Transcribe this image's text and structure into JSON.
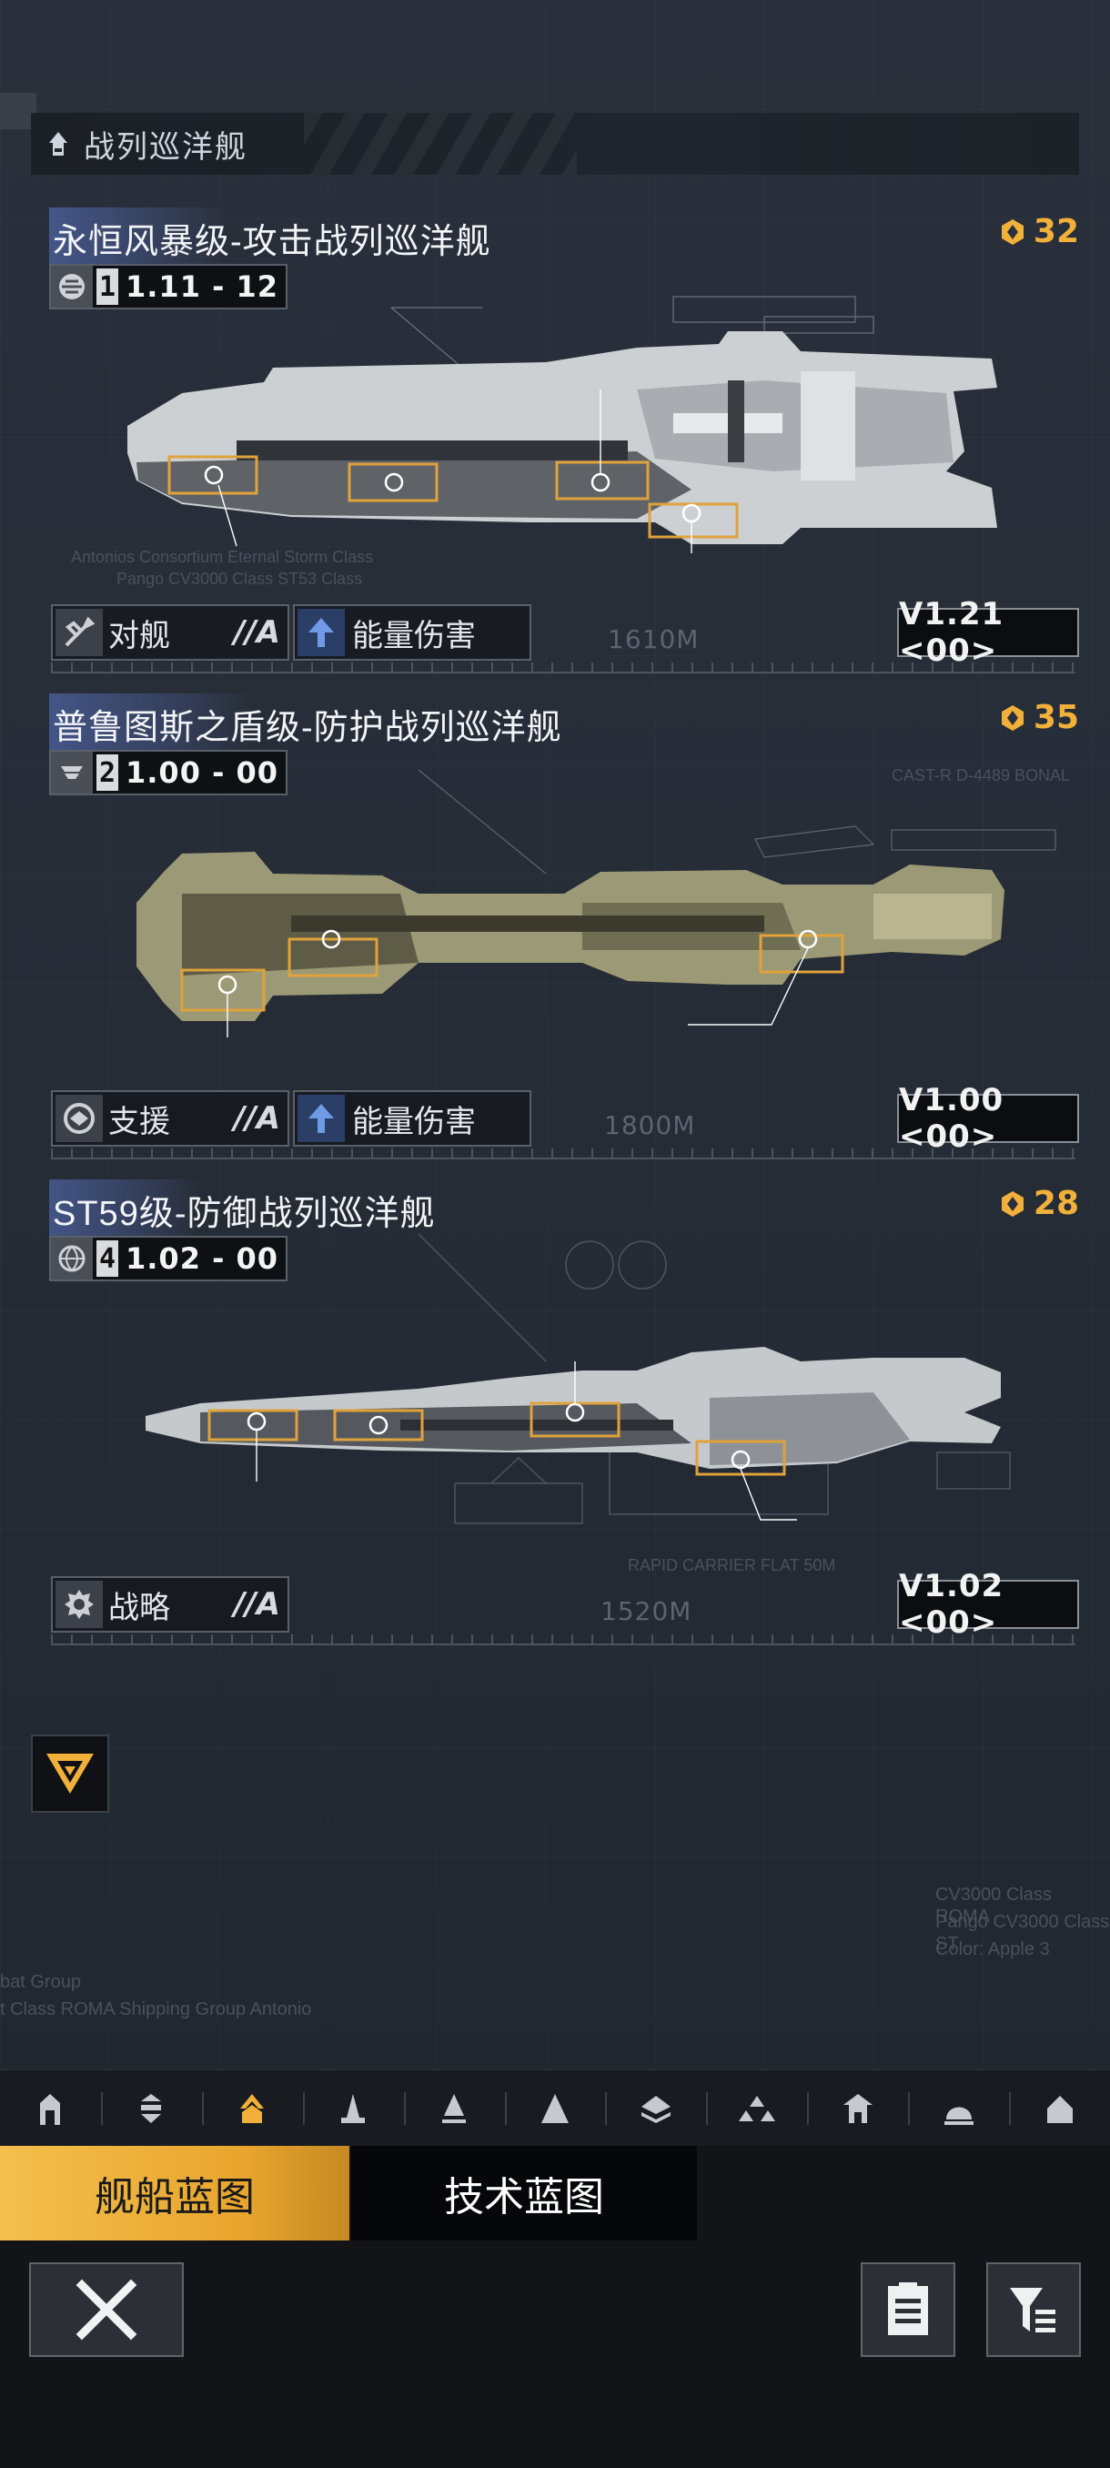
{
  "category": {
    "title": "战列巡洋舰",
    "icon": "cruiser-class-icon"
  },
  "ships": [
    {
      "name": "永恒风暴级-攻击战列巡洋舰",
      "cost": "32",
      "tier": "1",
      "version": "1.11 - 12",
      "faction_icon": "faction-emblem-icon",
      "role": "对舰",
      "role_grade": "//A",
      "role_icon": "anti-ship-icon",
      "damage": "能量伤害",
      "damage_icon": "energy-damage-icon",
      "variant": "V1.21 <00>",
      "length": "1610M",
      "hull_color": "#c9cbcd",
      "fluff": [
        "Antonios Consortium Eternal Storm Class",
        "Pango CV3000 Class ST53 Class"
      ]
    },
    {
      "name": "普鲁图斯之盾级-防护战列巡洋舰",
      "cost": "35",
      "tier": "2",
      "version": "1.00 - 00",
      "faction_icon": "faction-emblem-icon",
      "role": "支援",
      "role_grade": "//A",
      "role_icon": "support-icon",
      "damage": "能量伤害",
      "damage_icon": "energy-damage-icon",
      "variant": "V1.00 <00>",
      "length": "1800M",
      "hull_color": "#9a9873",
      "fluff": [
        "CAST-R D-4489 BONAL"
      ]
    },
    {
      "name": "ST59级-防御战列巡洋舰",
      "cost": "28",
      "tier": "4",
      "version": "1.02 - 00",
      "faction_icon": "globe-faction-icon",
      "role": "战略",
      "role_grade": "//A",
      "role_icon": "strategy-icon",
      "damage": "",
      "variant": "V1.02 <00>",
      "length": "1520M",
      "hull_color": "#c3c6ca",
      "fluff": [
        "RAPID CARRIER FLAT 50M"
      ]
    }
  ],
  "bg_text": [
    "CV3000 Class ROMA",
    "Pango CV3000 Class ST",
    "Color: Apple 3",
    "bat Group",
    "t Class ROMA Shipping Group Antonio"
  ],
  "class_filters": [
    "frigate-icon",
    "destroyer-icon",
    "cruiser-icon",
    "battlecruiser-icon",
    "auxiliary-icon",
    "carrier-icon",
    "battleship-icon",
    "flagship-icon",
    "base-icon",
    "dome-icon",
    "outpost-icon"
  ],
  "tabs": {
    "ship_blueprint": "舰船蓝图",
    "tech_blueprint": "技术蓝图"
  },
  "colors": {
    "accent": "#f1b03a",
    "name_highlight": "#5c76c8",
    "tab_active": "#e8a52e"
  }
}
